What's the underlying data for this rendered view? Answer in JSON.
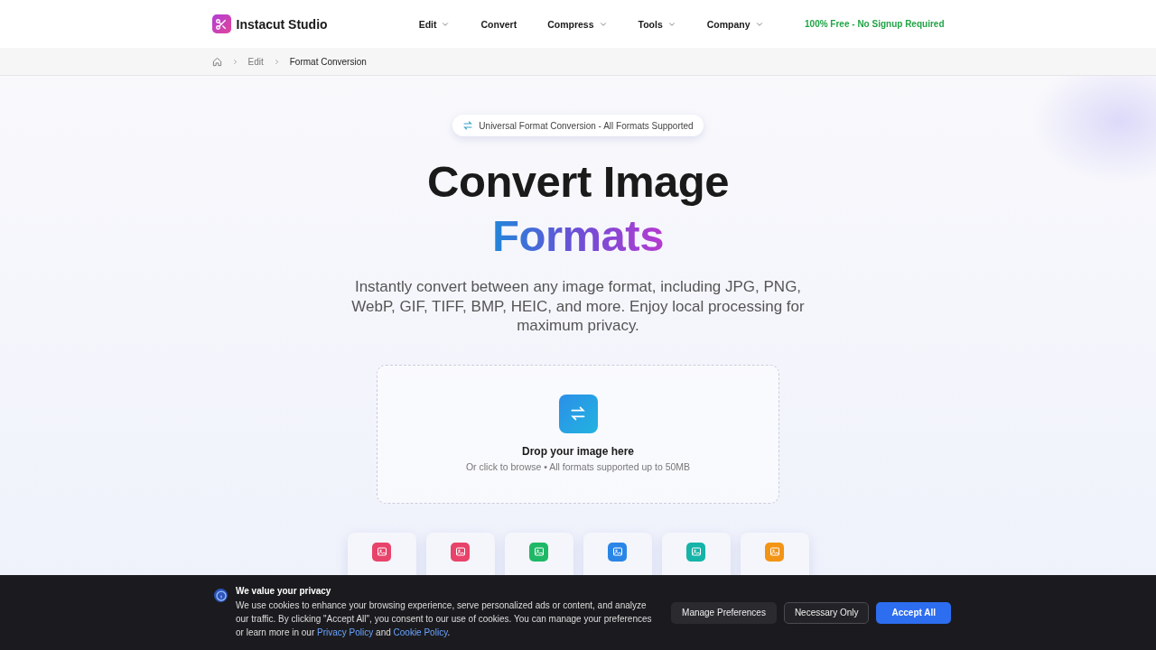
{
  "header": {
    "brand": "Instacut Studio",
    "nav": [
      {
        "label": "Edit",
        "dropdown": true
      },
      {
        "label": "Convert",
        "dropdown": false
      },
      {
        "label": "Compress",
        "dropdown": true
      },
      {
        "label": "Tools",
        "dropdown": true
      },
      {
        "label": "Company",
        "dropdown": true
      }
    ],
    "tagline": "100% Free - No Signup Required"
  },
  "breadcrumb": [
    "Edit",
    "Format Conversion"
  ],
  "hero": {
    "badge": "Universal Format Conversion - All Formats Supported",
    "title": "Convert Image",
    "title_accent": "Formats",
    "description": "Instantly convert between any image format, including JPG, PNG, WebP, GIF, TIFF, BMP, HEIC, and more. Enjoy local processing for maximum privacy."
  },
  "dropzone": {
    "title": "Drop your image here",
    "hint": "Or click to browse • All formats supported up to 50MB"
  },
  "formats": [
    {
      "color": "#e8436b"
    },
    {
      "color": "#e8436b"
    },
    {
      "color": "#1fb867"
    },
    {
      "color": "#2a86e6"
    },
    {
      "color": "#16b3a8"
    },
    {
      "color": "#f39415"
    }
  ],
  "cookie_banner": {
    "title": "We value your privacy",
    "text": "We use cookies to enhance your browsing experience, serve personalized ads or content, and analyze our traffic. By clicking \"Accept All\", you consent to our use of cookies. You can manage your preferences or learn more in our",
    "links": [
      "Privacy Policy",
      "Cookie Policy"
    ],
    "joiner": "and",
    "end": ".",
    "buttons": [
      {
        "label": "Manage Preferences",
        "kind": "ghost"
      },
      {
        "label": "Necessary Only",
        "kind": "outline"
      },
      {
        "label": "Accept All",
        "kind": "primary"
      }
    ]
  }
}
